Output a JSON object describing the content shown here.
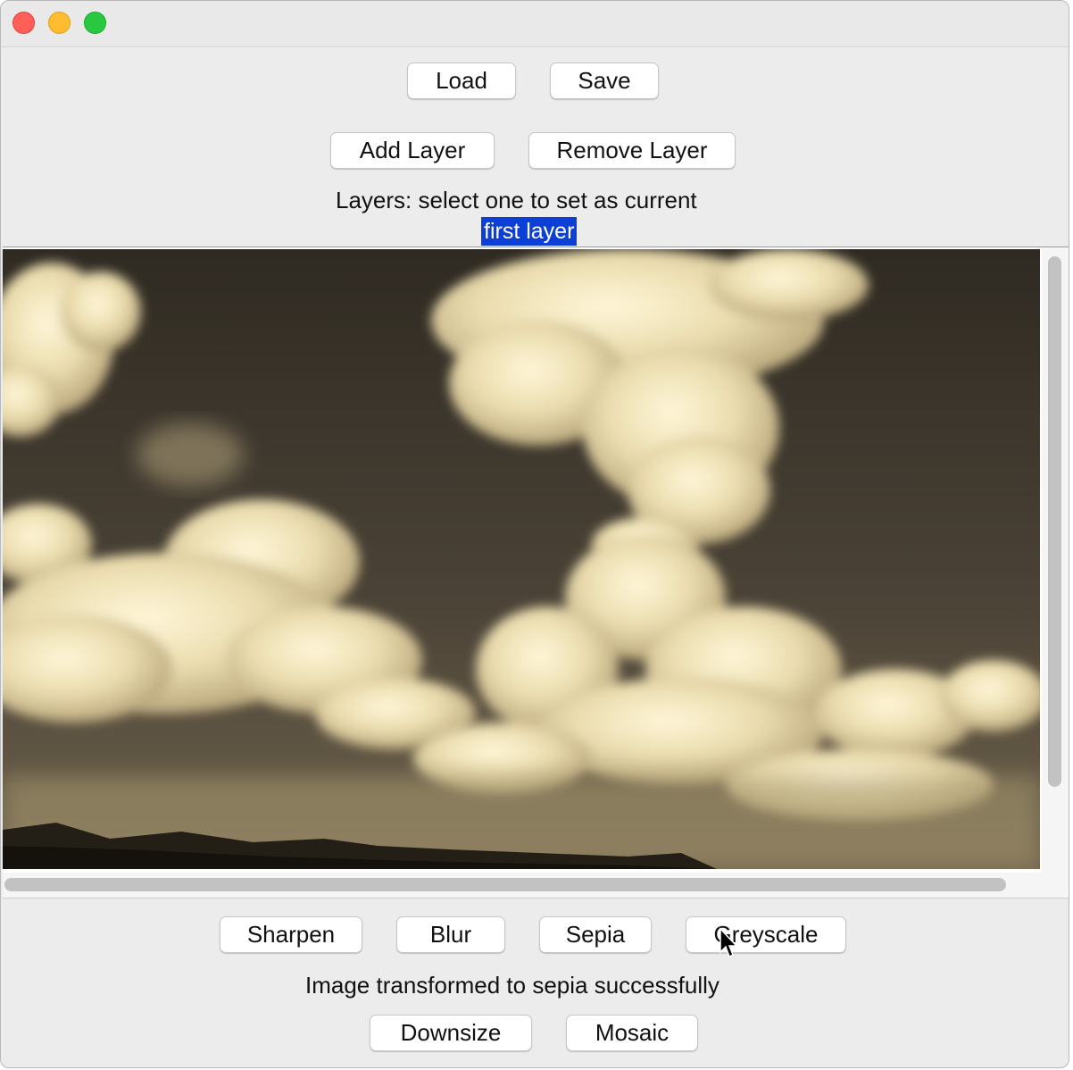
{
  "window": {
    "controls": [
      "close",
      "minimize",
      "zoom"
    ]
  },
  "toolbar_file": {
    "load_label": "Load",
    "save_label": "Save"
  },
  "toolbar_layers": {
    "add_layer_label": "Add Layer",
    "remove_layer_label": "Remove Layer"
  },
  "layers": {
    "instruction": "Layers: select one to set as current",
    "items": [
      {
        "label": "first layer",
        "selected": true
      }
    ],
    "selection_color": "#0b3fd6"
  },
  "canvas": {
    "image_icon": "sepia-clouds-photo",
    "tint": "sepia"
  },
  "filters": {
    "sharpen_label": "Sharpen",
    "blur_label": "Blur",
    "sepia_label": "Sepia",
    "greyscale_label": "Greyscale"
  },
  "status": {
    "message": "Image transformed to sepia successfully"
  },
  "resize": {
    "downsize_label": "Downsize",
    "mosaic_label": "Mosaic"
  }
}
